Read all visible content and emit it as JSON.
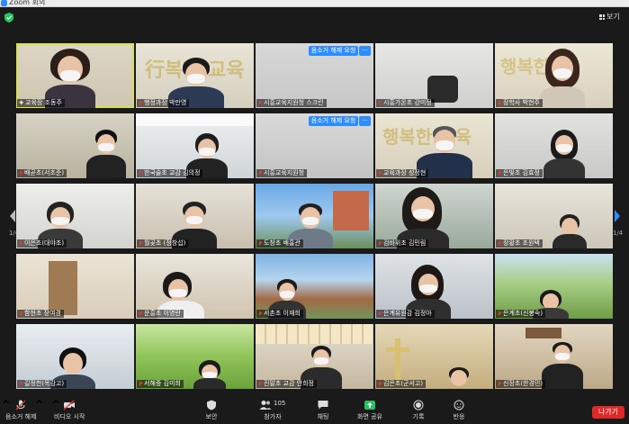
{
  "window": {
    "title": "Zoom 회의"
  },
  "view_button": {
    "label": "보기"
  },
  "unmute_request_label": "음소거 해제 요청",
  "more_label": "···",
  "pagination": {
    "left": "1/4",
    "right": "1/4"
  },
  "participants": [
    {
      "name": "교육장 조동주",
      "host": true
    },
    {
      "name": "행정과장 박만영"
    },
    {
      "name": "시흥교육지원청 스크린"
    },
    {
      "name": "시흥가온초 강미정"
    },
    {
      "name": "장학사 박현주"
    },
    {
      "name": "배곧초(서초준)"
    },
    {
      "name": "한국슬초 교감 김의정"
    },
    {
      "name": "시흥교육지원청"
    },
    {
      "name": "교육과장 성정현"
    },
    {
      "name": "은빛초 김효정"
    },
    {
      "name": "이은초(대야초)"
    },
    {
      "name": "월곶초 (정창섭)"
    },
    {
      "name": "도창초 배홍관"
    },
    {
      "name": "검바위초 김민림"
    },
    {
      "name": "장황초 조원택"
    },
    {
      "name": "함현초 장여경"
    },
    {
      "name": "운흥초 이명란"
    },
    {
      "name": "서촌초 이재희"
    },
    {
      "name": "은계유원감 김정아"
    },
    {
      "name": "은계초(신봉숙)"
    },
    {
      "name": "길정천(목감고)"
    },
    {
      "name": "서해중 김미희"
    },
    {
      "name": "진말초 교감 안희정"
    },
    {
      "name": "김은초(군서고)"
    },
    {
      "name": "신장초(한경민)"
    }
  ],
  "toolbar": {
    "unmute": "음소거 해제",
    "video": "비디오 시작",
    "security": "보안",
    "participants": "참가자",
    "participants_count": "105",
    "chat": "채팅",
    "share": "화면 공유",
    "record": "기록",
    "reactions": "반응",
    "leave": "나가기"
  },
  "colors": {
    "accent": "#2d8cff",
    "active_speaker": "#d4e157",
    "leave": "#e02828",
    "share": "#23c55e"
  }
}
